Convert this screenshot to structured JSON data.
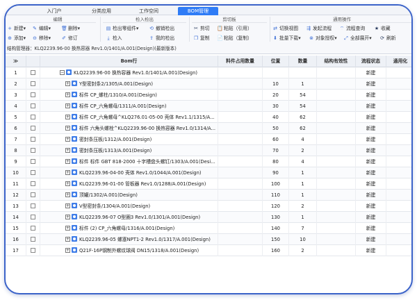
{
  "tabs": [
    {
      "label": "入门户"
    },
    {
      "label": "分类应用"
    },
    {
      "label": "工作空间"
    },
    {
      "label": "BOM管理"
    }
  ],
  "ribbon": {
    "groups": [
      {
        "title": "编辑"
      },
      {
        "title": "检入检出"
      },
      {
        "title": "剪切板"
      },
      {
        "title": "通用操作"
      }
    ],
    "edit": {
      "new": "新建",
      "edit": "编辑",
      "delete": "删除",
      "add": "添加",
      "remove": "移除",
      "revise": "修订"
    },
    "checkin": {
      "checkout_part": "检出零组件",
      "cancel_checkout": "撤销检出",
      "checkin": "检入",
      "my_checkout": "我的检出"
    },
    "clipboard": {
      "cut": "剪切",
      "paste_ref": "粘贴（引用）",
      "copy": "复制",
      "paste_copy": "粘贴（复制）"
    },
    "common": {
      "switch_view": "切换视图",
      "launch_flow": "发起流程",
      "flow_query": "流程查询",
      "favorite": "收藏",
      "batch_download": "批量下载",
      "object_auth": "对象授权",
      "expand_all": "全部展开",
      "refresh": "刷新"
    },
    "status_line": "结构管理器：KLQ2239.96-00 换热容器 Rev1.0/1401/A.001(Design)(最新版本)"
  },
  "table": {
    "headers": {
      "star": "≫",
      "bom_row": "Bom行",
      "qty_material": "料件占用数量",
      "position": "位置",
      "quantity": "数量",
      "validity": "结构有效性",
      "flow_status": "流程状态",
      "general": "通用化"
    },
    "rows": [
      {
        "no": "1",
        "text": "KLQ2239.96-00 换热容器 Rev1.0/1401/A.001(Design)",
        "pos": "",
        "qty": "",
        "status": "新建",
        "expander": "−"
      },
      {
        "no": "2",
        "text": "Y型密封条2/1305/A.001(Design)",
        "pos": "10",
        "qty": "1",
        "status": "新建",
        "expander": "+"
      },
      {
        "no": "3",
        "text": "标件 CP_螺柱/1310/A.001(Design)",
        "pos": "20",
        "qty": "54",
        "status": "新建",
        "expander": "+"
      },
      {
        "no": "4",
        "text": "标件 CP_六角螺母/1311/A.001(Design)",
        "pos": "30",
        "qty": "54",
        "status": "新建",
        "expander": "+"
      },
      {
        "no": "5",
        "text": "标件 CP_六角螺母^KLQ276.01-05-00 壳体 Rev1.1/1315/A...",
        "pos": "40",
        "qty": "62",
        "status": "新建",
        "expander": "+"
      },
      {
        "no": "6",
        "text": "标件 六角头螺栓^KLQ2239.96-00 换热容器 Rev1.0/1314/A...",
        "pos": "50",
        "qty": "62",
        "status": "新建",
        "expander": "+"
      },
      {
        "no": "7",
        "text": "密封条压板/1312/A.001(Design)",
        "pos": "60",
        "qty": "4",
        "status": "新建",
        "expander": "+"
      },
      {
        "no": "8",
        "text": "密封条压板/1313/A.001(Design)",
        "pos": "70",
        "qty": "2",
        "status": "新建",
        "expander": "+"
      },
      {
        "no": "9",
        "text": "标件 标件 GBT 818-2000 十字槽盘头螺钉/1303/A.001(Desi...",
        "pos": "80",
        "qty": "4",
        "status": "新建",
        "expander": "+"
      },
      {
        "no": "10",
        "text": "KLQ2239.96-04-00 壳体 Rev1.0/1044/A.001(Design)",
        "pos": "90",
        "qty": "1",
        "status": "新建",
        "expander": "+"
      },
      {
        "no": "11",
        "text": "KLQ2239.96-01-00 管板器 Rev1.0/1288/A.001(Design)",
        "pos": "100",
        "qty": "1",
        "status": "新建",
        "expander": "+"
      },
      {
        "no": "12",
        "text": "顶罐/1302/A.001(Design)",
        "pos": "110",
        "qty": "1",
        "status": "新建",
        "expander": "+"
      },
      {
        "no": "13",
        "text": "V型密封条/1304/A.001(Design)",
        "pos": "120",
        "qty": "2",
        "status": "新建",
        "expander": "+"
      },
      {
        "no": "14",
        "text": "KLQ2239.96-07 O型圈3 Rev1.0/1301/A.001(Design)",
        "pos": "130",
        "qty": "1",
        "status": "新建",
        "expander": "+"
      },
      {
        "no": "15",
        "text": "标件 (2) CP_六角螺母/1316/A.001(Design)",
        "pos": "140",
        "qty": "7",
        "status": "新建",
        "expander": "+"
      },
      {
        "no": "16",
        "text": "KLQ2239.96-05 螺塞NPT1-2 Rev1.0/1317/A.001(Design)",
        "pos": "150",
        "qty": "10",
        "status": "新建",
        "expander": "+"
      },
      {
        "no": "17",
        "text": "Q21F-16P钢制外螺纹球阀 DN15/1318/A.001(Design)",
        "pos": "160",
        "qty": "2",
        "status": "新建",
        "expander": "+"
      }
    ]
  }
}
